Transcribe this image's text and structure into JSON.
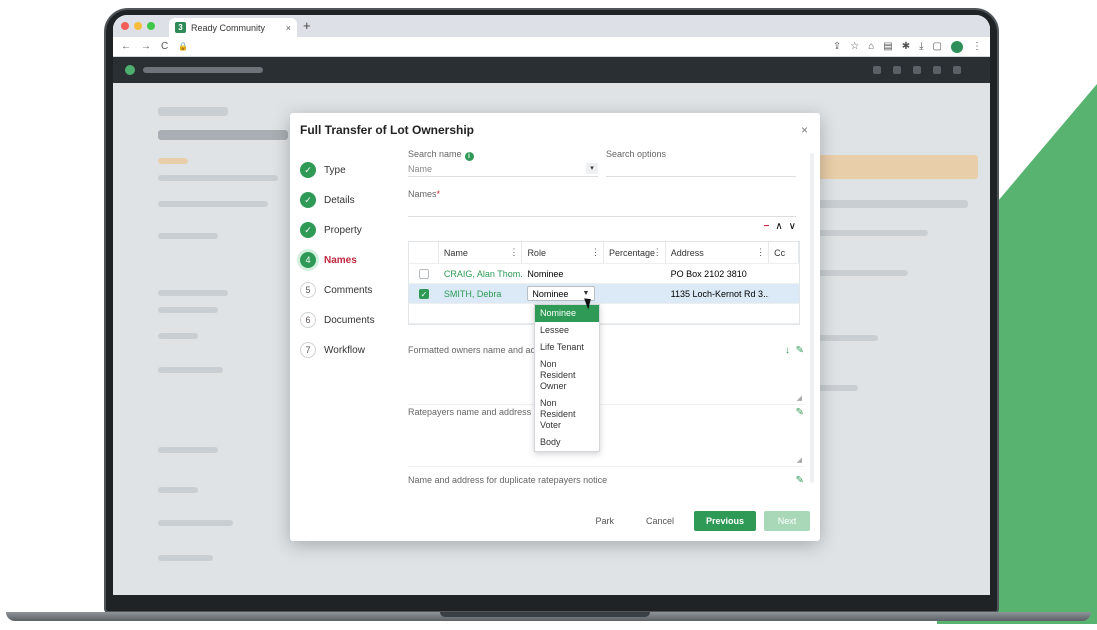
{
  "browser": {
    "tab_title": "Ready Community",
    "favicon_glyph": "3",
    "tab_close": "×",
    "new_tab": "+",
    "nav_back": "←",
    "nav_forward": "→",
    "nav_reload": "C",
    "nav_lock": "🔒"
  },
  "modal": {
    "title": "Full Transfer of Lot Ownership",
    "close_glyph": "×",
    "steps": [
      {
        "label": "Type",
        "glyph": "✓"
      },
      {
        "label": "Details",
        "glyph": "✓"
      },
      {
        "label": "Property",
        "glyph": "✓"
      },
      {
        "label": "Names",
        "glyph": "4"
      },
      {
        "label": "Comments",
        "glyph": "5"
      },
      {
        "label": "Documents",
        "glyph": "6"
      },
      {
        "label": "Workflow",
        "glyph": "7"
      }
    ],
    "search_name_label": "Search name",
    "search_name_value": "Name",
    "search_options_label": "Search options",
    "names_label": "Names",
    "required_mark": "*",
    "grid_tools": {
      "remove": "−",
      "up": "∧",
      "down": "∨"
    },
    "grid": {
      "headers": [
        "Name",
        "Role",
        "Percentage",
        "Address",
        "Cc"
      ],
      "rows": [
        {
          "name": "CRAIG, Alan Thom...",
          "role": "Nominee",
          "percentage": "",
          "address": "PO Box 2102 3810",
          "checked": false
        },
        {
          "name": "SMITH, Debra",
          "role": "Nominee",
          "percentage": "",
          "address": "1135 Loch-Kernot Rd 3...",
          "checked": true
        }
      ]
    },
    "role_options": [
      "Nominee",
      "Lessee",
      "Life Tenant",
      "Non Resident Owner",
      "Non Resident Voter",
      "Body"
    ],
    "formatted_owners_label": "Formatted owners name and addre",
    "ratepayers_label": "Ratepayers name and address",
    "duplicate_notice_label": "Name and address for duplicate ratepayers notice",
    "buttons": {
      "park": "Park",
      "cancel": "Cancel",
      "previous": "Previous",
      "next": "Next"
    }
  },
  "colors": {
    "accent": "#2e9a56",
    "active_step": "#c0283e",
    "brand_shape": "#57b36f"
  }
}
